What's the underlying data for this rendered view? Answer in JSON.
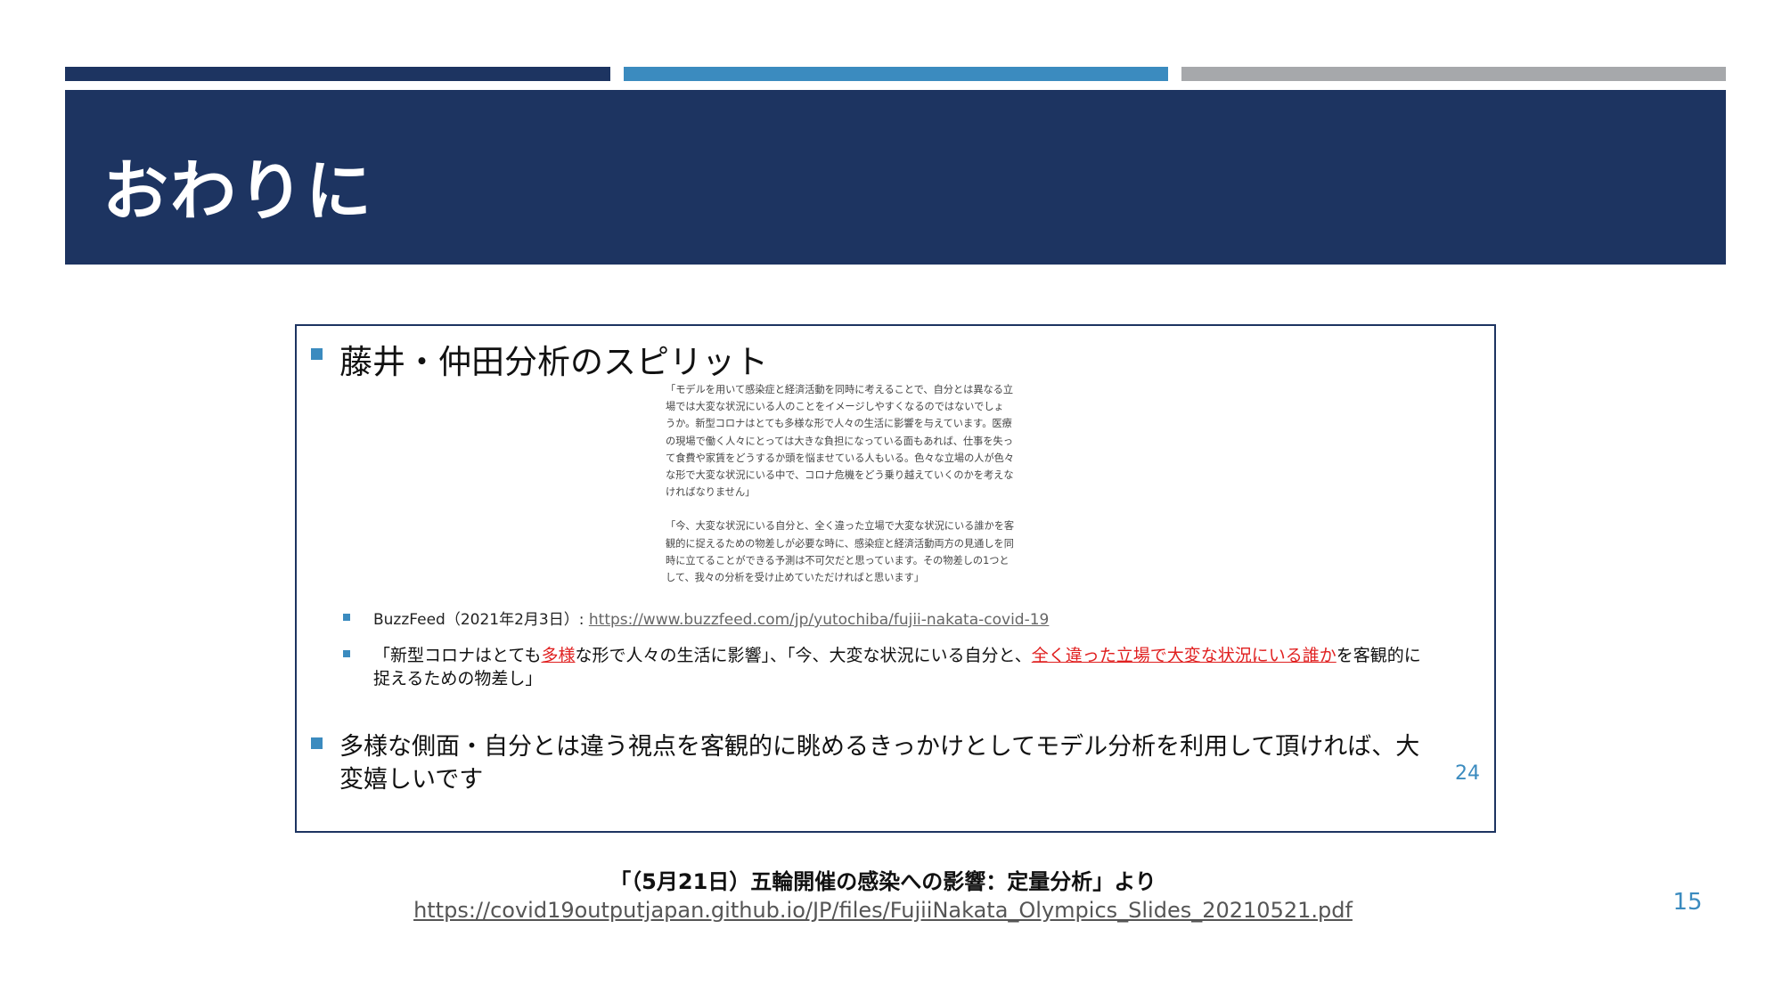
{
  "header": {
    "title": "おわりに"
  },
  "inner_slide": {
    "title": "藤井・仲田分析のスピリット",
    "quote_paragraphs": [
      [
        "「モデルを用いて感染症と経済活動を同時に考えることで、自分とは異なる立",
        "場では大変な状況にいる人のことをイメージしやすくなるのではないでしょ",
        "うか。新型コロナはとても多様な形で人々の生活に影響を与えています。医療",
        "の現場で働く人々にとっては大きな負担になっている面もあれば、仕事を失っ",
        "て食費や家賃をどうするか頭を悩ませている人もいる。色々な立場の人が色々",
        "な形で大変な状況にいる中で、コロナ危機をどう乗り越えていくのかを考えな",
        "ければなりません」"
      ],
      [
        "「今、大変な状況にいる自分と、全く違った立場で大変な状況にいる誰かを客",
        "観的に捉えるための物差しが必要な時に、感染症と経済活動両方の見通しを同",
        "時に立てることができる予測は不可欠だと思っています。その物差しの1つと",
        "して、我々の分析を受け止めていただければと思います」"
      ]
    ],
    "source_label": "BuzzFeed（2021年2月3日）: ",
    "source_url": "https://www.buzzfeed.com/jp/yutochiba/fujii-nakata-covid-19",
    "citation": {
      "part1": "「新型コロナはとても",
      "red1": "多様",
      "part2": "な形で人々の生活に影響」、「今、大変な状況にいる自分と、",
      "red2": "全く違った立場で大変な状況にいる誰か",
      "part3": "を客観的に",
      "line2": "捉えるための物差し」"
    },
    "bullet2_line1": "多様な側面・自分とは違う視点を客観的に眺めるきっかけとしてモデル分析を利用して頂ければ、大",
    "bullet2_line2": "変嬉しいです",
    "page_number": "24"
  },
  "caption": {
    "text": "「（5月21日）五輪開催の感染への影響：定量分析」より",
    "url": "https://covid19outputjapan.github.io/JP/files/FujiiNakata_Olympics_Slides_20210521.pdf"
  },
  "page_number": "15",
  "colors": {
    "navy": "#1d3461",
    "blue": "#3b8bbf",
    "gray": "#a6a8ab",
    "red": "#e02020"
  }
}
